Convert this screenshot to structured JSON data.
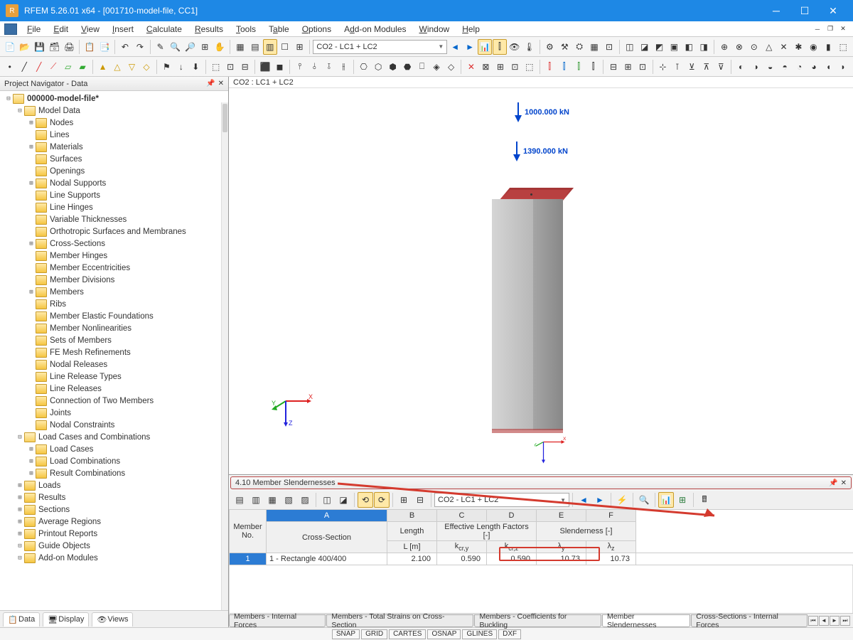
{
  "app": {
    "title": "RFEM 5.26.01 x64 - [001710-model-file, CC1]"
  },
  "menu": [
    "File",
    "Edit",
    "View",
    "Insert",
    "Calculate",
    "Results",
    "Tools",
    "Table",
    "Options",
    "Add-on Modules",
    "Window",
    "Help"
  ],
  "toolbar_combo": "CO2 - LC1 + LC2",
  "navigator": {
    "title": "Project Navigator - Data",
    "root": "000000-model-file*",
    "groups": {
      "model_data": "Model Data",
      "model_items": [
        "Nodes",
        "Lines",
        "Materials",
        "Surfaces",
        "Openings",
        "Nodal Supports",
        "Line Supports",
        "Line Hinges",
        "Variable Thicknesses",
        "Orthotropic Surfaces and Membranes",
        "Cross-Sections",
        "Member Hinges",
        "Member Eccentricities",
        "Member Divisions",
        "Members",
        "Ribs",
        "Member Elastic Foundations",
        "Member Nonlinearities",
        "Sets of Members",
        "FE Mesh Refinements",
        "Nodal Releases",
        "Line Release Types",
        "Line Releases",
        "Connection of Two Members",
        "Joints",
        "Nodal Constraints"
      ],
      "load_cases": "Load Cases and Combinations",
      "lc_items": [
        "Load Cases",
        "Load Combinations",
        "Result Combinations"
      ],
      "other": [
        "Loads",
        "Results",
        "Sections",
        "Average Regions",
        "Printout Reports",
        "Guide Objects",
        "Add-on Modules"
      ]
    },
    "tabs": [
      "Data",
      "Display",
      "Views"
    ]
  },
  "viewport": {
    "header": "CO2 : LC1 + LC2",
    "load1": "1000.000 kN",
    "load2": "1390.000 kN",
    "axes": {
      "x": "X",
      "y": "Y",
      "z": "Z"
    }
  },
  "results": {
    "title": "4.10 Member Slendernesses",
    "combo": "CO2 - LC1 + LC2",
    "letter_cols": [
      "A",
      "B",
      "C",
      "D",
      "E",
      "F"
    ],
    "header_groups": {
      "member_no": "Member\nNo.",
      "cross_section": "Cross-Section",
      "length": "Length",
      "length_unit": "L [m]",
      "eff_factors": "Effective Length Factors [-]",
      "kcry": "k_cr,y",
      "kcrz": "k_cr,z",
      "slenderness": "Slenderness [-]",
      "ly": "λ_y",
      "lz": "λ_z"
    },
    "row": {
      "no": "1",
      "cs": "1 - Rectangle 400/400",
      "L": "2.100",
      "kcry": "0.590",
      "kcrz": "0.590",
      "ly": "10.73",
      "lz": "10.73"
    },
    "tabs": [
      "Members - Internal Forces",
      "Members - Total Strains on Cross-Section",
      "Members - Coefficients for Buckling",
      "Member Slendernesses",
      "Cross-Sections - Internal Forces"
    ]
  },
  "statusbar": [
    "SNAP",
    "GRID",
    "CARTES",
    "OSNAP",
    "GLINES",
    "DXF"
  ]
}
